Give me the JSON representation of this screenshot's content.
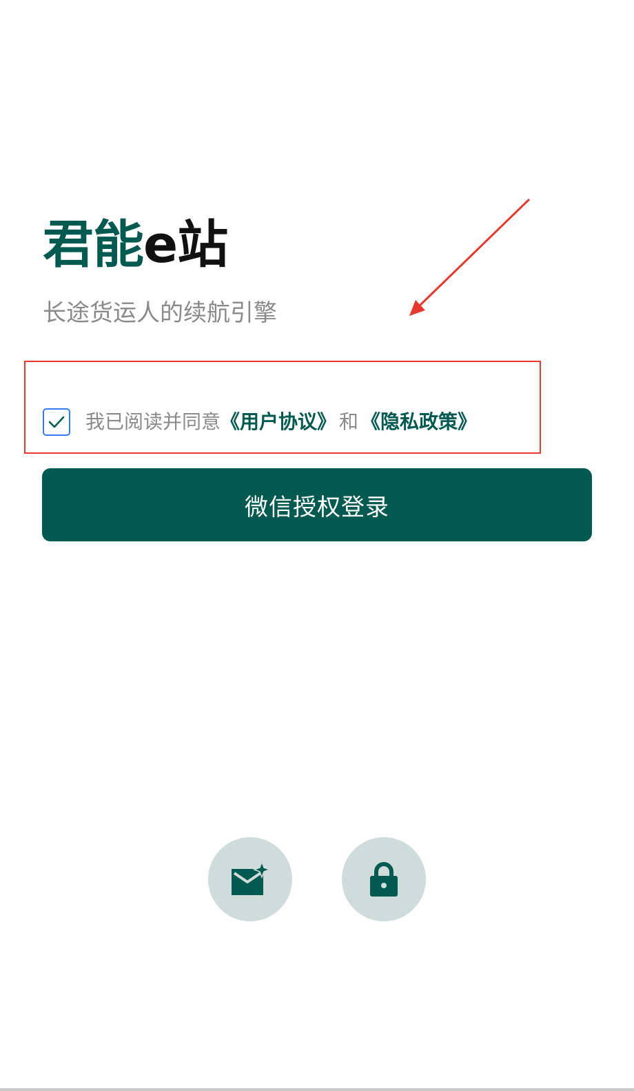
{
  "colors": {
    "brand": "#005a50",
    "brand_light": "#cfdcd9",
    "annotation": "#e8372c",
    "checkbox_border": "#2f7df0"
  },
  "header": {
    "title_brand": "君能",
    "title_suffix": "e站",
    "subtitle": "长途货运人的续航引擎"
  },
  "agreement": {
    "checked": true,
    "text": "我已阅读并同意",
    "user_agreement_link": "《用户协议》",
    "and_text": "和",
    "privacy_policy_link": "《隐私政策》"
  },
  "login_button": {
    "label": "微信授权登录"
  },
  "alt_login": {
    "icons": [
      "email-icon",
      "lock-icon"
    ]
  }
}
